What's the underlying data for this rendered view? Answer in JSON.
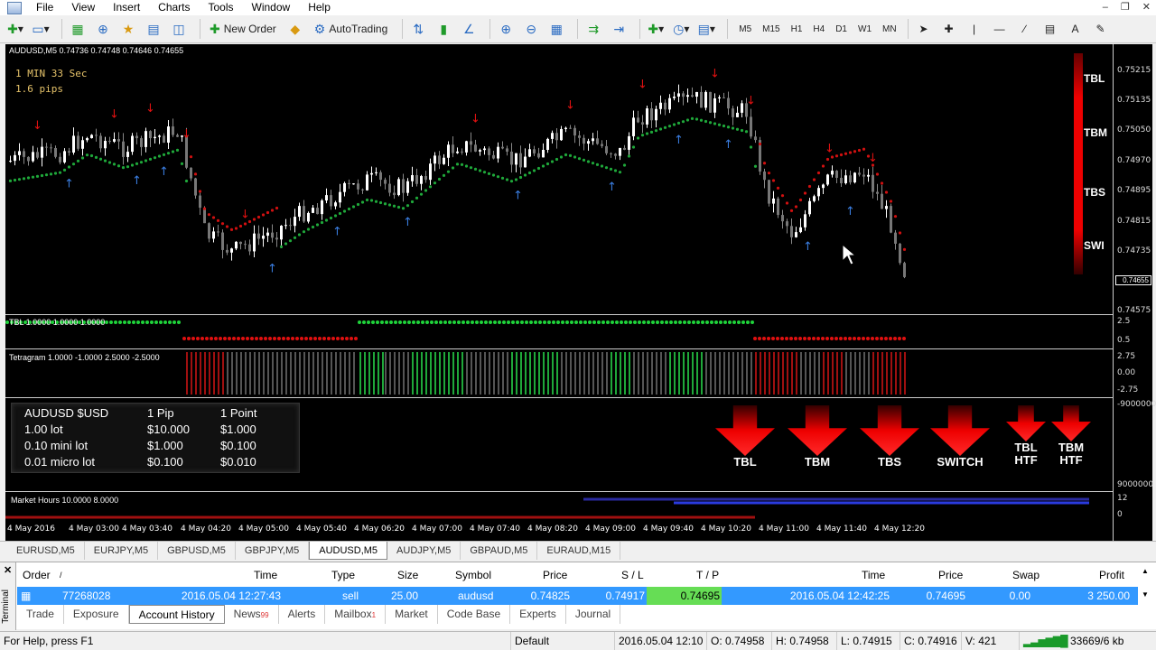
{
  "menu": [
    "File",
    "View",
    "Insert",
    "Charts",
    "Tools",
    "Window",
    "Help"
  ],
  "toolbar": {
    "new_order": "New Order",
    "autotrading": "AutoTrading",
    "timeframes": [
      "M5",
      "M15",
      "H1",
      "H4",
      "D1",
      "W1",
      "MN"
    ]
  },
  "chart": {
    "symbol_header": "AUDUSD,M5  0.74736 0.74748 0.74646 0.74655",
    "countdown": "1 MIN 33 Sec",
    "spread": "1.6 pips",
    "signal_labels": [
      "TBL",
      "TBM",
      "TBS",
      "SWI"
    ],
    "price_scale": [
      "0.75215",
      "0.75135",
      "0.75050",
      "0.74970",
      "0.74895",
      "0.74815",
      "0.74735",
      "0.74575"
    ],
    "current_price": "0.74655",
    "pane2_label": "TBL 1.0000 1.0000 1.0000",
    "pane2_scale": [
      "2.5",
      "0.5"
    ],
    "pane3_label": "Tetragram 1.0000 -1.0000 2.5000 -2.5000",
    "pane3_scale": [
      "2.75",
      "0.00",
      "-2.75"
    ],
    "pane4_scale": [
      "-9000000",
      "9000000"
    ],
    "pane5_label": "Market Hours 10.0000 8.0000",
    "pane5_scale": [
      "12",
      "0"
    ],
    "time_axis": [
      "4 May 2016",
      "4 May 03:00",
      "4 May 03:40",
      "4 May 04:20",
      "4 May 05:00",
      "4 May 05:40",
      "4 May 06:20",
      "4 May 07:00",
      "4 May 07:40",
      "4 May 08:20",
      "4 May 09:00",
      "4 May 09:40",
      "4 May 10:20",
      "4 May 11:00",
      "4 May 11:40",
      "4 May 12:20"
    ],
    "colors": {
      "bull": "#1fa83a",
      "bear": "#d01010",
      "up_arrow": "#3a7de0",
      "down_arrow": "#e01010"
    }
  },
  "pip_table": {
    "rows": [
      [
        "AUDUSD $USD",
        "1 Pip",
        "1 Point"
      ],
      [
        "1.00 lot",
        "$10.000",
        "$1.000"
      ],
      [
        "0.10 mini lot",
        "$1.000",
        "$0.100"
      ],
      [
        "0.01 micro lot",
        "$0.100",
        "$0.010"
      ]
    ]
  },
  "signal_arrows": [
    {
      "label": "TBL"
    },
    {
      "label": "TBM"
    },
    {
      "label": "TBS"
    },
    {
      "label": "SWITCH"
    },
    {
      "label": "TBL\nHTF"
    },
    {
      "label": "TBM\nHTF"
    }
  ],
  "chart_tabs": [
    "EURUSD,M5",
    "EURJPY,M5",
    "GBPUSD,M5",
    "GBPJPY,M5",
    "AUDUSD,M5",
    "AUDJPY,M5",
    "GBPAUD,M5",
    "EURAUD,M15"
  ],
  "active_chart_tab": "AUDUSD,M5",
  "terminal": {
    "side_label": "Terminal",
    "headers": [
      "Order",
      "/",
      "Time",
      "Type",
      "Size",
      "Symbol",
      "Price",
      "S / L",
      "T / P",
      "Time",
      "Price",
      "Swap",
      "Profit"
    ],
    "row": {
      "order": "77268028",
      "open_time": "2016.05.04 12:27:43",
      "type": "sell",
      "size": "25.00",
      "symbol": "audusd",
      "price": "0.74825",
      "sl": "0.74917",
      "tp": "0.74695",
      "close_time": "2016.05.04 12:42:25",
      "close_price": "0.74695",
      "swap": "0.00",
      "profit": "3 250.00"
    },
    "tabs": [
      "Trade",
      "Exposure",
      "Account History",
      "News",
      "Alerts",
      "Mailbox",
      "Market",
      "Code Base",
      "Experts",
      "Journal"
    ],
    "active_tab": "Account History",
    "news_badge": "99",
    "mailbox_badge": "1"
  },
  "status": {
    "help": "For Help, press F1",
    "profile": "Default",
    "datetime": "2016.05.04 12:10",
    "open": "O: 0.74958",
    "high": "H: 0.74958",
    "low": "L: 0.74915",
    "close": "C: 0.74916",
    "volume": "V: 421",
    "traffic": "33669/6 kb"
  }
}
